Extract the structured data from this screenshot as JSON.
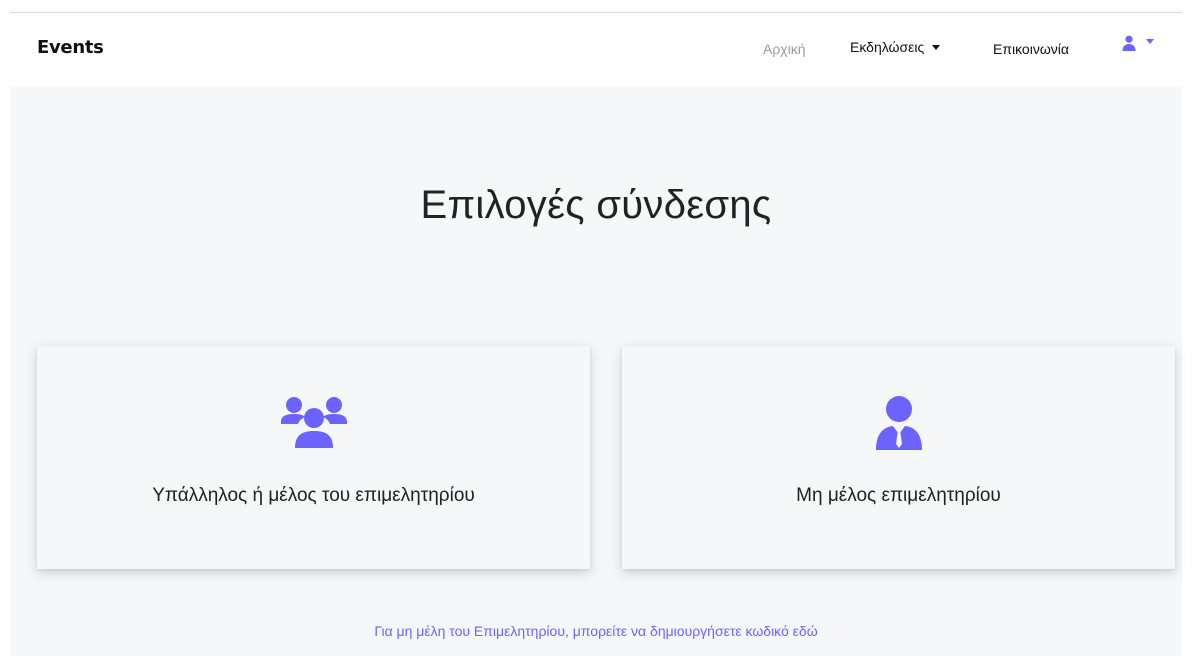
{
  "navbar": {
    "brand": "Events",
    "links": {
      "home": "Αρχική",
      "events": "Εκδηλώσεις",
      "contact": "Επικοινωνία"
    },
    "user_icon": "user-icon"
  },
  "main": {
    "title": "Επιλογές σύνδεσης",
    "cards": [
      {
        "label": "Υπάλληλος ή μέλος του επιμελητηρίου",
        "icon": "users-group-icon"
      },
      {
        "label": "Μη μέλος επιμελητηρίου",
        "icon": "user-tie-icon"
      }
    ],
    "footer_link": "Για μη μέλη του Επιμελητηρίου, μπορείτε να δημιουργήσετε κωδικό εδώ"
  },
  "colors": {
    "accent": "#6c63ff",
    "background": "#f6f7f9",
    "muted_link": "#9a9a9a"
  }
}
